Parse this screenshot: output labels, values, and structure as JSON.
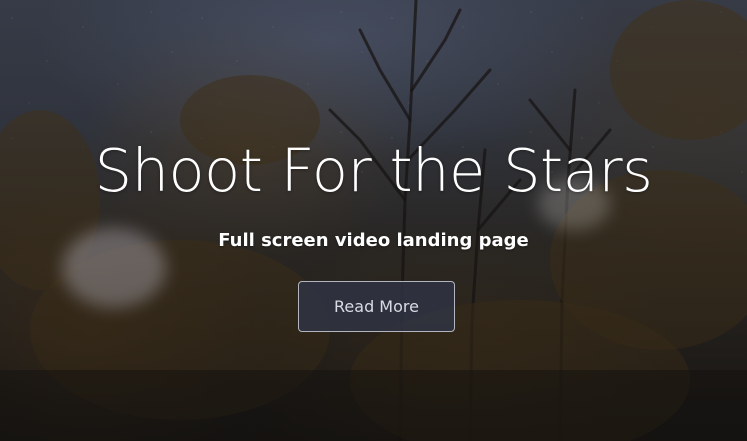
{
  "hero": {
    "title": "Shoot For the Stars",
    "subtitle": "Full screen video landing page",
    "button_label": "Read More"
  },
  "colors": {
    "title_text": "#ffffff",
    "button_background": "#303444",
    "button_border": "#c8cdd7",
    "button_text": "#d9dbe2"
  },
  "background": {
    "description_icon": "night-forest-video-background"
  }
}
